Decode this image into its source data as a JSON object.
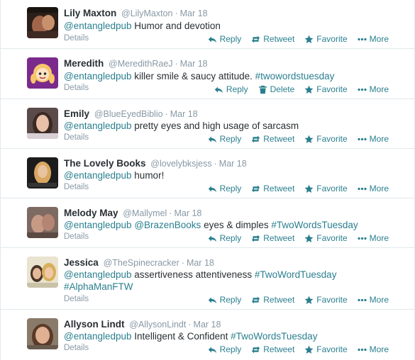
{
  "colors": {
    "link": "#2a7f8f",
    "meta": "#8899a6",
    "divider": "#e1e8ed"
  },
  "tweets": [
    {
      "name": "Lily Maxton",
      "handle": "@LilyMaxton",
      "time": "Mar 18",
      "mention": "@entangledpub",
      "text": " Humor and devotion",
      "hashtag": "",
      "hashtag2": "",
      "mention2": "",
      "details": "Details",
      "actions": {
        "reply": "Reply",
        "retweet": "Retweet",
        "favorite": "Favorite",
        "more": "More"
      },
      "avatar_icon": "profile-photo"
    },
    {
      "name": "Meredith",
      "handle": "@MeredithRaeJ",
      "time": "Mar 18",
      "mention": "@entangledpub",
      "text": " killer smile & saucy attitude. ",
      "hashtag": "#twowordstuesday",
      "details": "Details",
      "actions": {
        "reply": "Reply",
        "delete": "Delete",
        "favorite": "Favorite",
        "more": "More"
      },
      "avatar_icon": "cartoon-avatar"
    },
    {
      "name": "Emily",
      "handle": "@BlueEyedBiblio",
      "time": "Mar 18",
      "mention": "@entangledpub",
      "text": " pretty eyes and high usage of sarcasm",
      "details": "Details",
      "actions": {
        "reply": "Reply",
        "retweet": "Retweet",
        "favorite": "Favorite",
        "more": "More"
      },
      "avatar_icon": "profile-photo"
    },
    {
      "name": "The Lovely Books",
      "handle": "@lovelybksjess",
      "time": "Mar 18",
      "mention": "@entangledpub",
      "text": " humor!",
      "details": "Details",
      "actions": {
        "reply": "Reply",
        "retweet": "Retweet",
        "favorite": "Favorite",
        "more": "More"
      },
      "avatar_icon": "profile-photo"
    },
    {
      "name": "Melody May",
      "handle": "@Mallymel",
      "time": "Mar 18",
      "mention": "@entangledpub",
      "mention2": "@BrazenBooks",
      "text": " eyes & dimples ",
      "hashtag": "#TwoWordsTuesday",
      "details": "Details",
      "actions": {
        "reply": "Reply",
        "retweet": "Retweet",
        "favorite": "Favorite",
        "more": "More"
      },
      "avatar_icon": "profile-photo"
    },
    {
      "name": "Jessica",
      "handle": "@TheSpinecracker",
      "time": "Mar 18",
      "mention": "@entangledpub",
      "text": " assertiveness attentiveness ",
      "hashtag": "#TwoWordTuesday",
      "hashtag2": "#AlphaManFTW",
      "details": "Details",
      "actions": {
        "reply": "Reply",
        "retweet": "Retweet",
        "favorite": "Favorite",
        "more": "More"
      },
      "avatar_icon": "profile-photo"
    },
    {
      "name": "Allyson Lindt",
      "handle": "@AllysonLindt",
      "time": "Mar 18",
      "mention": "@entangledpub",
      "text": " Intelligent & Confident ",
      "hashtag": "#TwoWordsTuesday",
      "details": "Details",
      "actions": {
        "reply": "Reply",
        "retweet": "Retweet",
        "favorite": "Favorite",
        "more": "More"
      },
      "avatar_icon": "profile-photo"
    }
  ]
}
